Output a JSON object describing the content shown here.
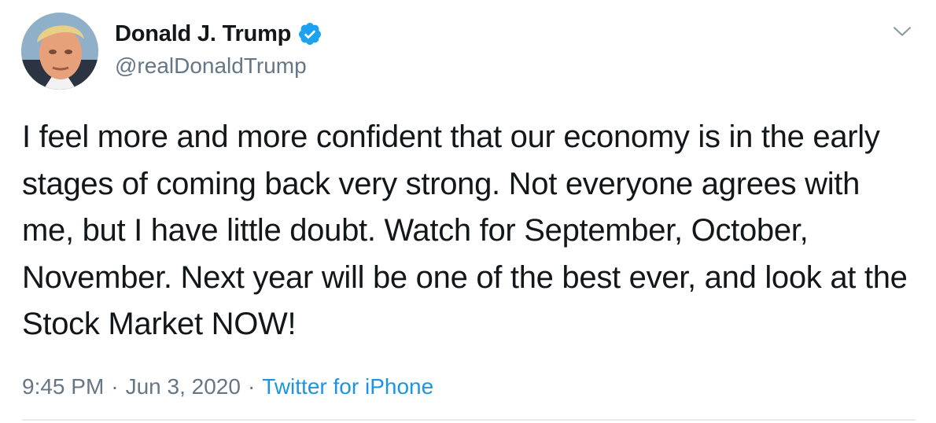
{
  "author": {
    "display_name": "Donald J. Trump",
    "handle": "@realDonaldTrump",
    "verified": true
  },
  "tweet": {
    "text": "I feel more and more confident that our economy is in the early stages of coming back very strong. Not everyone agrees with me, but I have little doubt. Watch for September, October, November. Next year will be one of the best ever, and look at the Stock Market NOW!",
    "time": "9:45 PM",
    "date": "Jun 3, 2020",
    "separator": "·",
    "source": "Twitter for iPhone"
  },
  "icons": {
    "verified": "verified-badge-icon",
    "more": "chevron-down-icon"
  },
  "colors": {
    "text": "#14171a",
    "secondary": "#657786",
    "link": "#1b95e0",
    "verified": "#1da1f2",
    "divider": "#e6ecf0"
  }
}
